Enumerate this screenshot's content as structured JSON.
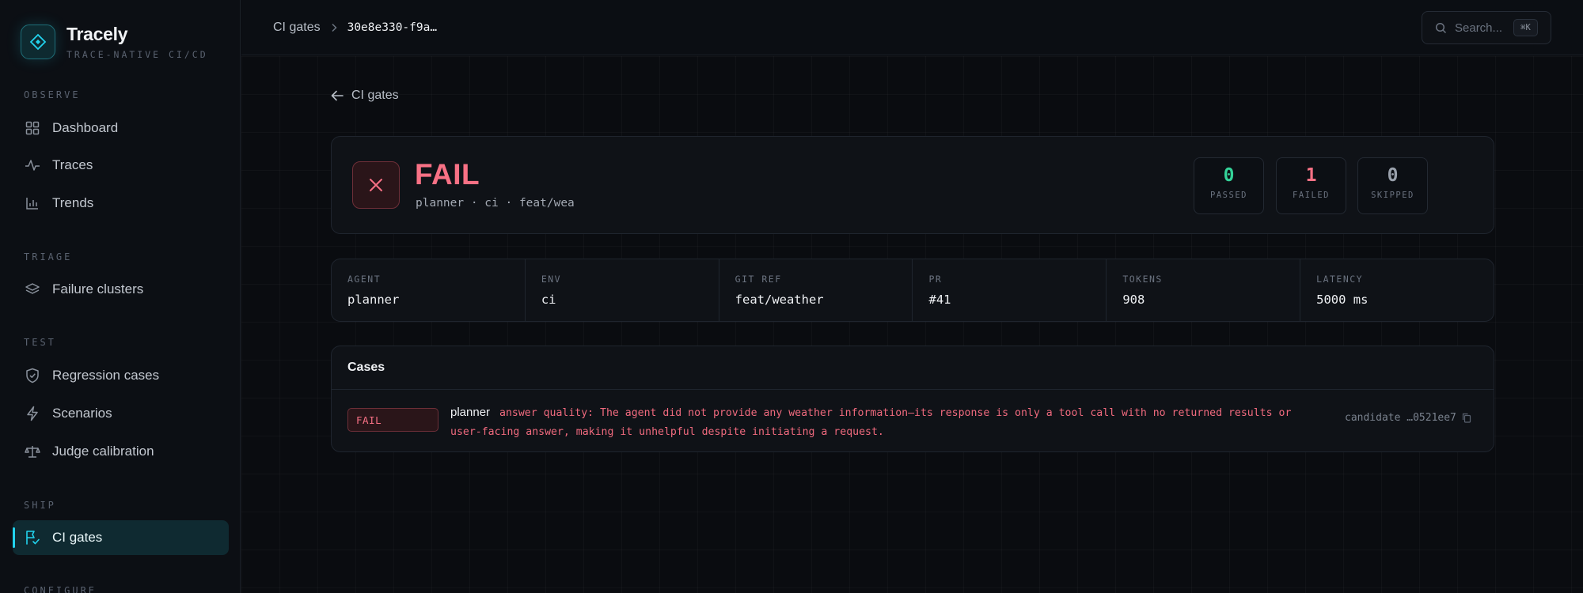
{
  "brand": {
    "name": "Tracely",
    "tagline": "TRACE-NATIVE CI/CD",
    "logo_icon": "diamond-logo-icon"
  },
  "sidebar": {
    "sections": [
      {
        "title": "OBSERVE",
        "items": [
          {
            "label": "Dashboard",
            "icon": "grid-icon"
          },
          {
            "label": "Traces",
            "icon": "activity-icon"
          },
          {
            "label": "Trends",
            "icon": "bar-chart-icon"
          }
        ]
      },
      {
        "title": "TRIAGE",
        "items": [
          {
            "label": "Failure clusters",
            "icon": "layers-icon"
          }
        ]
      },
      {
        "title": "TEST",
        "items": [
          {
            "label": "Regression cases",
            "icon": "shield-check-icon"
          },
          {
            "label": "Scenarios",
            "icon": "zap-icon"
          },
          {
            "label": "Judge calibration",
            "icon": "scale-icon"
          }
        ]
      },
      {
        "title": "SHIP",
        "items": [
          {
            "label": "CI gates",
            "icon": "flag-check-icon",
            "active": true
          }
        ]
      },
      {
        "title": "CONFIGURE",
        "items": []
      }
    ]
  },
  "topbar": {
    "breadcrumb": [
      "CI gates",
      "30e8e330-f9a…"
    ],
    "search_placeholder": "Search...",
    "search_shortcut": "⌘K"
  },
  "back_link": "CI gates",
  "status": {
    "result": "FAIL",
    "subtitle": "planner · ci · feat/wea",
    "stats": [
      {
        "value": "0",
        "label": "PASSED",
        "color": "#34d399"
      },
      {
        "value": "1",
        "label": "FAILED",
        "color": "#f87185"
      },
      {
        "value": "0",
        "label": "SKIPPED",
        "color": "#9aa1ac"
      }
    ]
  },
  "meta": [
    {
      "label": "AGENT",
      "value": "planner"
    },
    {
      "label": "ENV",
      "value": "ci"
    },
    {
      "label": "GIT REF",
      "value": "feat/weather"
    },
    {
      "label": "PR",
      "value": "#41"
    },
    {
      "label": "TOKENS",
      "value": "908"
    },
    {
      "label": "LATENCY",
      "value": "5000 ms"
    }
  ],
  "cases": {
    "title": "Cases",
    "rows": [
      {
        "status": "FAIL",
        "agent": "planner",
        "message": "answer quality: The agent did not provide any weather information—its response is only a tool call with no returned results or user-facing answer, making it unhelpful despite initiating a request.",
        "candidate": "candidate …0521ee7"
      }
    ]
  },
  "colors": {
    "accent": "#22d3ee",
    "fail": "#f87185",
    "pass": "#34d399",
    "background": "#0a0c10"
  }
}
